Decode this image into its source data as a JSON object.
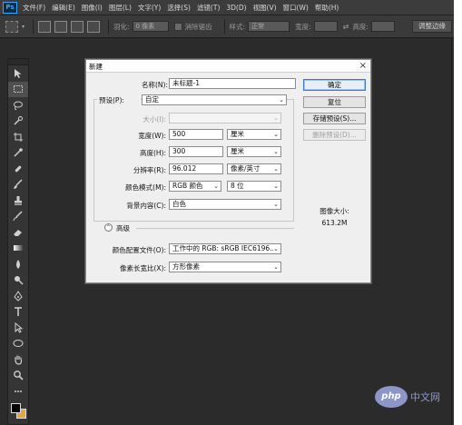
{
  "app": {
    "logo": "Ps",
    "menu": [
      "文件(F)",
      "编辑(E)",
      "图像(I)",
      "图层(L)",
      "文字(Y)",
      "选择(S)",
      "滤镜(T)",
      "3D(D)",
      "视图(V)",
      "窗口(W)",
      "帮助(H)"
    ]
  },
  "options_bar": {
    "feather_label": "羽化:",
    "feather_value": "0 像素",
    "antialias_label": "消除锯齿",
    "style_label": "样式:",
    "style_value": "正常",
    "width_label": "宽度:",
    "height_label": "高度:",
    "swap_icon": "⇄",
    "refine_button": "调整边缘"
  },
  "tools": [
    "move",
    "marquee",
    "lasso",
    "quick-select",
    "crop",
    "eyedropper",
    "healing",
    "brush",
    "stamp",
    "history-brush",
    "eraser",
    "gradient",
    "blur",
    "dodge",
    "pen",
    "type",
    "path-select",
    "shape",
    "hand",
    "zoom"
  ],
  "dialog": {
    "title": "新建",
    "close": "×",
    "name_label": "名称(N):",
    "name_value": "未标题-1",
    "preset_label": "预设(P):",
    "preset_value": "自定",
    "size_label": "大小(I):",
    "size_value": "",
    "width_label": "宽度(W):",
    "width_value": "500",
    "width_unit": "厘米",
    "height_label": "高度(H):",
    "height_value": "300",
    "height_unit": "厘米",
    "resolution_label": "分辨率(R):",
    "resolution_value": "96.012",
    "resolution_unit": "像素/英寸",
    "color_mode_label": "颜色模式(M):",
    "color_mode_value": "RGB 颜色",
    "bit_depth_value": "8 位",
    "background_label": "背景内容(C):",
    "background_value": "白色",
    "advanced_label": "高级",
    "advanced_icon": "⌃",
    "color_profile_label": "颜色配置文件(O):",
    "color_profile_value": "工作中的 RGB: sRGB IEC6196...",
    "pixel_aspect_label": "像素长宽比(X):",
    "pixel_aspect_value": "方形像素",
    "ok_button": "确定",
    "reset_button": "复位",
    "save_preset_button": "存储预设(S)...",
    "delete_preset_button": "删除预设(D)...",
    "image_size_label": "图像大小:",
    "image_size_value": "613.2M",
    "chevron": "⌄"
  },
  "watermark": {
    "logo": "php",
    "text": "中文网"
  }
}
